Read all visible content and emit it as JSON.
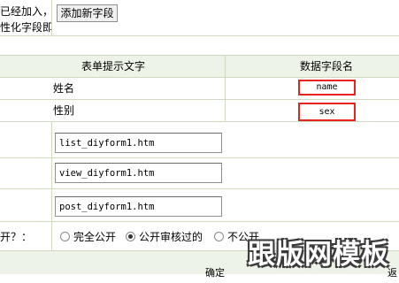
{
  "top": {
    "line1": "已经加入，",
    "line2": "性化字段即",
    "add_button": "添加新字段"
  },
  "table": {
    "header_label": "表单提示文字",
    "header_field": "数据字段名",
    "rows": [
      {
        "label": "姓名",
        "field": "name"
      },
      {
        "label": "性别",
        "field": "sex"
      }
    ]
  },
  "templates": {
    "list": "list_diyform1.htm",
    "view": "view_diyform1.htm",
    "post": "post_diyform1.htm"
  },
  "public_setting": {
    "label": "开？：",
    "options": [
      "完全公开",
      "公开审核过的",
      "不公开"
    ],
    "selected": "公开审核过的"
  },
  "footer": {
    "confirm_partial": "确定",
    "right_partial": "返"
  },
  "watermark": "跟版网模板",
  "colors": {
    "grid": "#cfd9c2",
    "header_bg": "#eef3e8",
    "highlight": "#e8221f"
  }
}
